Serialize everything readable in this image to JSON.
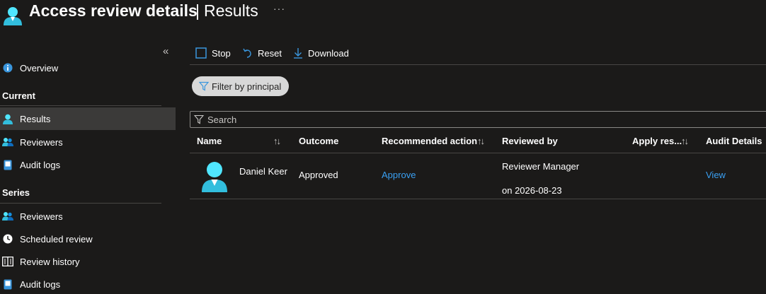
{
  "header": {
    "title": "Access review details",
    "separator": "|",
    "subtitle": "Results",
    "more": "···",
    "icon": "user-icon"
  },
  "sidebar": {
    "collapse": "«",
    "overview": {
      "label": "Overview",
      "icon": "info-icon"
    },
    "current_section": "Current",
    "current_items": [
      {
        "label": "Results",
        "icon": "user-icon",
        "active": true
      },
      {
        "label": "Reviewers",
        "icon": "users-icon"
      },
      {
        "label": "Audit logs",
        "icon": "log-icon"
      }
    ],
    "series_section": "Series",
    "series_items": [
      {
        "label": "Reviewers",
        "icon": "users-icon"
      },
      {
        "label": "Scheduled review",
        "icon": "clock-icon"
      },
      {
        "label": "Review history",
        "icon": "book-icon"
      },
      {
        "label": "Audit logs",
        "icon": "log-icon"
      }
    ]
  },
  "toolbar": {
    "stop": "Stop",
    "reset": "Reset",
    "download": "Download"
  },
  "filter": {
    "label": "Filter by principal",
    "icon": "filter-icon"
  },
  "search": {
    "placeholder": "Search",
    "value": ""
  },
  "table": {
    "columns": {
      "name": "Name",
      "outcome": "Outcome",
      "recommended": "Recommended action",
      "reviewed_by": "Reviewed by",
      "apply": "Apply res...",
      "audit": "Audit Details"
    },
    "sort_glyph": "↑↓",
    "rows": [
      {
        "name": "Daniel Keer",
        "outcome": "Approved",
        "recommended": "Approve",
        "reviewed_by": "Reviewer Manager",
        "reviewed_on": "on 2026-08-23",
        "apply": "",
        "audit": "View"
      }
    ]
  },
  "colors": {
    "background": "#1b1a19",
    "active_nav": "#3b3a39",
    "link": "#3aa0f3",
    "accent_icon": "#50e6ff"
  }
}
